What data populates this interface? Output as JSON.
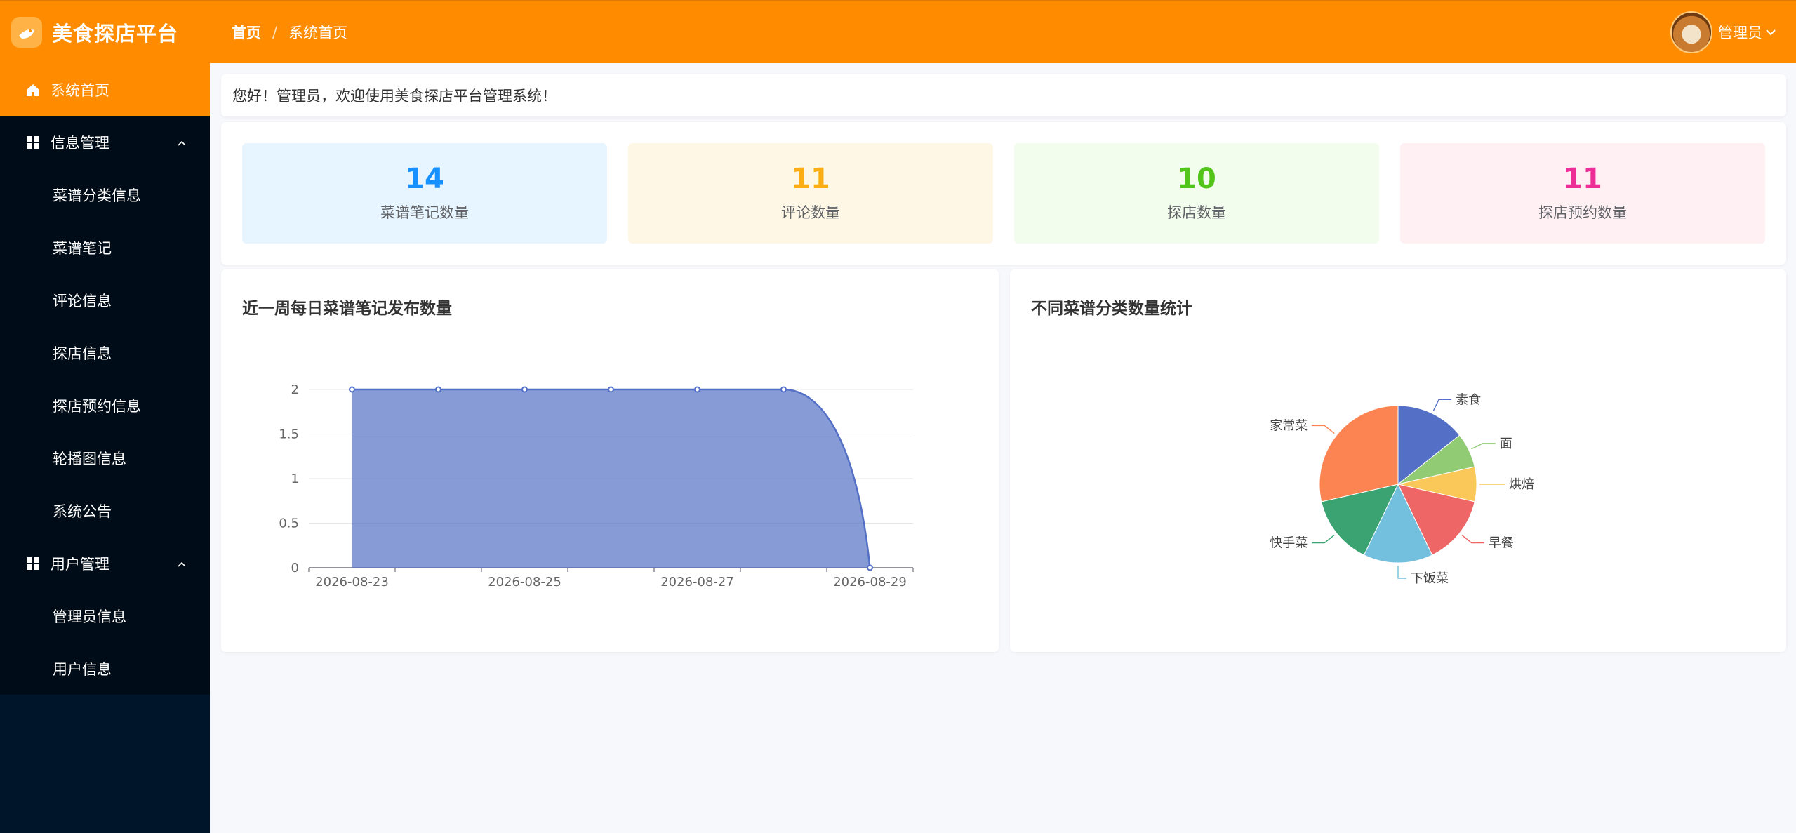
{
  "app": {
    "title": "美食探店平台"
  },
  "breadcrumb": {
    "home": "首页",
    "separator": "/",
    "current": "系统首页"
  },
  "user": {
    "name": "管理员"
  },
  "sidebar": {
    "items": [
      {
        "label": "系统首页"
      },
      {
        "label": "信息管理"
      },
      {
        "label": "菜谱分类信息"
      },
      {
        "label": "菜谱笔记"
      },
      {
        "label": "评论信息"
      },
      {
        "label": "探店信息"
      },
      {
        "label": "探店预约信息"
      },
      {
        "label": "轮播图信息"
      },
      {
        "label": "系统公告"
      },
      {
        "label": "用户管理"
      },
      {
        "label": "管理员信息"
      },
      {
        "label": "用户信息"
      }
    ]
  },
  "welcome": {
    "text": "您好！管理员，欢迎使用美食探店平台管理系统！"
  },
  "stats": [
    {
      "value": "14",
      "label": "菜谱笔记数量",
      "color": "#1890ff",
      "bg": "#e6f5ff"
    },
    {
      "value": "11",
      "label": "评论数量",
      "color": "#faad14",
      "bg": "#fff7e6"
    },
    {
      "value": "10",
      "label": "探店数量",
      "color": "#52c41a",
      "bg": "#f3fded"
    },
    {
      "value": "11",
      "label": "探店预约数量",
      "color": "#eb2f96",
      "bg": "#fff0f4"
    }
  ],
  "charts": {
    "line_title": "近一周每日菜谱笔记发布数量",
    "pie_title": "不同菜谱分类数量统计"
  },
  "chart_data": [
    {
      "type": "area",
      "title": "近一周每日菜谱笔记发布数量",
      "x": [
        "2026-08-23",
        "2026-08-24",
        "2026-08-25",
        "2026-08-26",
        "2026-08-27",
        "2026-08-28",
        "2026-08-29"
      ],
      "x_tick_labels": [
        "2026-08-23",
        "2026-08-25",
        "2026-08-27",
        "2026-08-29"
      ],
      "values": [
        2,
        2,
        2,
        2,
        2,
        2,
        0
      ],
      "ylim": [
        0,
        2
      ],
      "y_ticks": [
        "0",
        "0.5",
        "1",
        "1.5",
        "2"
      ],
      "grid": true,
      "color": "#5470c6"
    },
    {
      "type": "pie",
      "title": "不同菜谱分类数量统计",
      "slices": [
        {
          "label": "素食",
          "value": 2,
          "color": "#5470c6"
        },
        {
          "label": "面",
          "value": 1,
          "color": "#91cc75"
        },
        {
          "label": "烘焙",
          "value": 1,
          "color": "#fac858"
        },
        {
          "label": "早餐",
          "value": 2,
          "color": "#ee6666"
        },
        {
          "label": "下饭菜",
          "value": 2,
          "color": "#73c0de"
        },
        {
          "label": "快手菜",
          "value": 2,
          "color": "#3ba272"
        },
        {
          "label": "家常菜",
          "value": 4,
          "color": "#fc8452"
        }
      ]
    }
  ]
}
